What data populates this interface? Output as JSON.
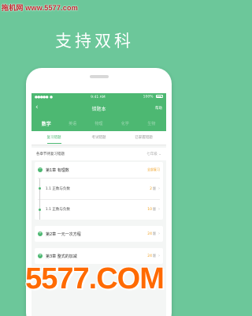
{
  "watermark": {
    "top": "拖机网 www.5577.com",
    "bottom": "5577.COM"
  },
  "headline": "支持双科",
  "statusbar": {
    "carrier": "●●●●●",
    "network": "●",
    "time": "9:41 AM",
    "battery": "100%"
  },
  "nav": {
    "title": "错题本",
    "right": "帮助"
  },
  "subjects": [
    {
      "label": "数学",
      "active": true
    },
    {
      "label": "英语",
      "active": false
    },
    {
      "label": "物理",
      "active": false
    },
    {
      "label": "化学",
      "active": false
    },
    {
      "label": "生物",
      "active": false
    }
  ],
  "tabs": [
    {
      "label": "复习错题",
      "active": true
    },
    {
      "label": "考试错题",
      "active": false
    },
    {
      "label": "已掌握错题",
      "active": false
    }
  ],
  "filter": {
    "left": "各章节待复习错题",
    "right": "七年级"
  },
  "chapters": [
    {
      "title": "第1章 有理数",
      "action": "全部复习",
      "sections": [
        {
          "title": "1.1 正数与负数",
          "count": "2",
          "unit": "题"
        },
        {
          "title": "1.1 正数与负数",
          "count": "10",
          "unit": "题"
        }
      ]
    },
    {
      "title": "第2章 一元一次方程",
      "count": "24",
      "unit": "题"
    },
    {
      "title": "第3章 整式的加减",
      "count": "24",
      "unit": "题"
    }
  ],
  "colors": {
    "brand": "#4db872",
    "background": "#6cc79a",
    "accent": "#f0a020"
  }
}
